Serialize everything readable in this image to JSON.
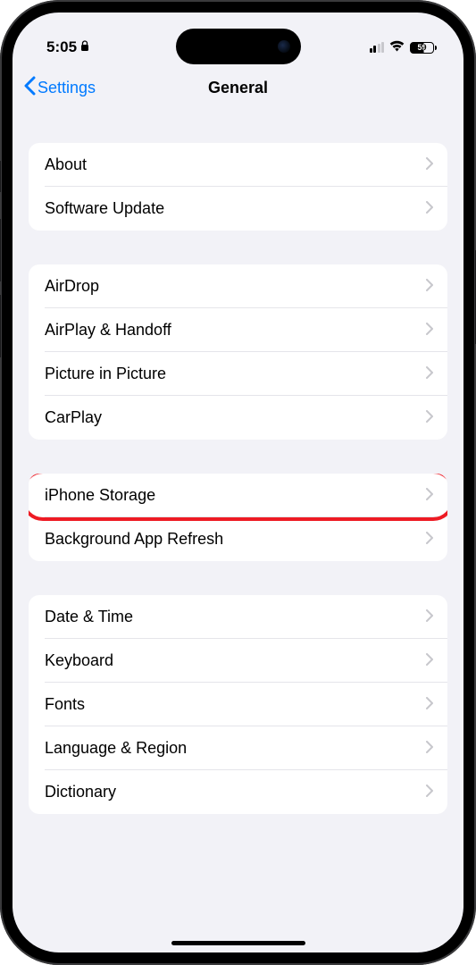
{
  "status_bar": {
    "time": "5:05",
    "battery_level": "59"
  },
  "nav": {
    "back_label": "Settings",
    "title": "General"
  },
  "sections": [
    {
      "items": [
        {
          "label": "About"
        },
        {
          "label": "Software Update"
        }
      ]
    },
    {
      "items": [
        {
          "label": "AirDrop"
        },
        {
          "label": "AirPlay & Handoff"
        },
        {
          "label": "Picture in Picture"
        },
        {
          "label": "CarPlay"
        }
      ]
    },
    {
      "items": [
        {
          "label": "iPhone Storage",
          "highlighted": true
        },
        {
          "label": "Background App Refresh"
        }
      ]
    },
    {
      "items": [
        {
          "label": "Date & Time"
        },
        {
          "label": "Keyboard"
        },
        {
          "label": "Fonts"
        },
        {
          "label": "Language & Region"
        },
        {
          "label": "Dictionary"
        }
      ]
    }
  ]
}
